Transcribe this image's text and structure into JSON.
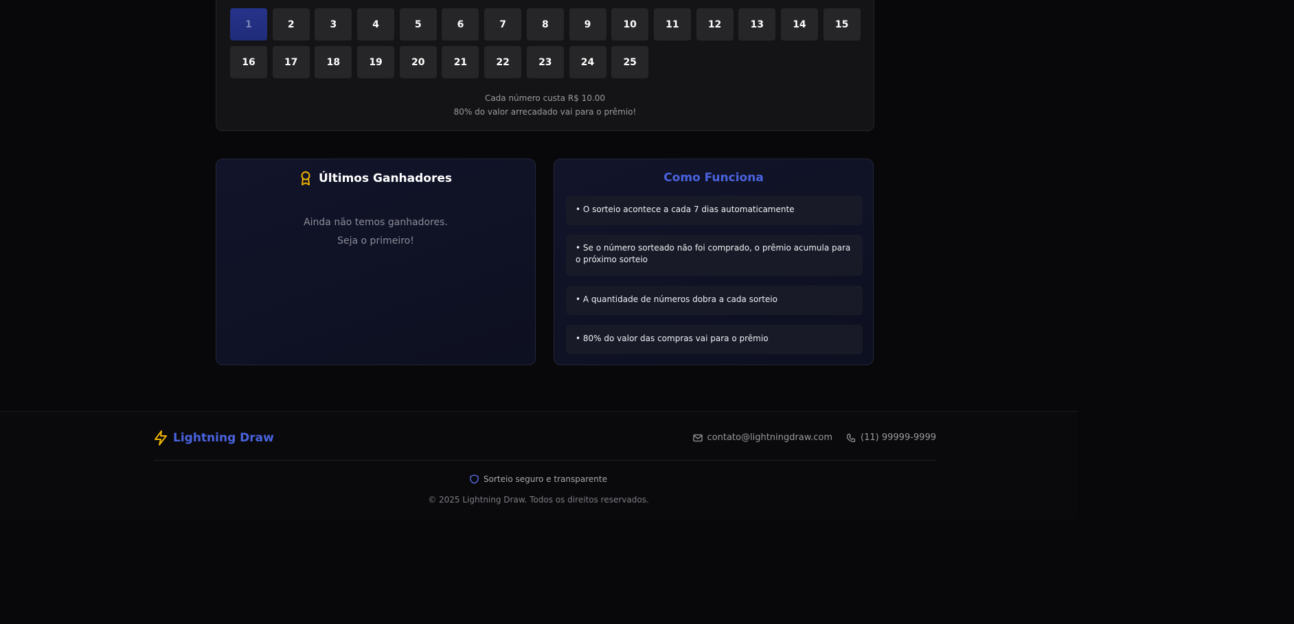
{
  "numbers": {
    "items": [
      "1",
      "2",
      "3",
      "4",
      "5",
      "6",
      "7",
      "8",
      "9",
      "10",
      "11",
      "12",
      "13",
      "14",
      "15",
      "16",
      "17",
      "18",
      "19",
      "20",
      "21",
      "22",
      "23",
      "24",
      "25"
    ],
    "selected": "1",
    "price_line": "Cada número custa R$ 10.00",
    "prize_line": "80% do valor arrecadado vai para o prêmio!"
  },
  "winners": {
    "title": "Últimos Ganhadores",
    "empty_line1": "Ainda não temos ganhadores.",
    "empty_line2": "Seja o primeiro!"
  },
  "how": {
    "title": "Como Funciona",
    "items": [
      "• O sorteio acontece a cada 7 dias automaticamente",
      "• Se o número sorteado não foi comprado, o prêmio acumula para o próximo sorteio",
      "• A quantidade de números dobra a cada sorteio",
      "• 80% do valor das compras vai para o prêmio"
    ]
  },
  "footer": {
    "brand": "Lightning Draw",
    "email": "contato@lightningdraw.com",
    "phone": "(11) 99999-9999",
    "secure": "Sorteio seguro e transparente",
    "copyright": "© 2025 Lightning Draw. Todos os direitos reservados."
  },
  "colors": {
    "accent": "#4a63e0",
    "gold": "#f0b400",
    "selected": "#27338a",
    "background": "#08080a"
  },
  "icons": [
    "award-icon",
    "bolt-icon",
    "mail-icon",
    "phone-icon",
    "shield-icon"
  ]
}
